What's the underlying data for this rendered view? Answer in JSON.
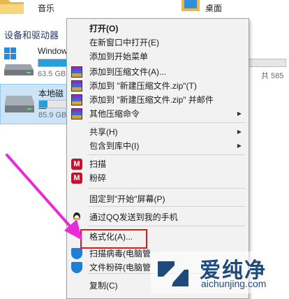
{
  "explorer": {
    "folders": [
      {
        "label": "音乐"
      },
      {
        "label": "桌面"
      }
    ],
    "section_title": "设备和驱动器",
    "drives": [
      {
        "name": "Windows",
        "size_text": "63.5 GB",
        "free_text": "共 585",
        "used_fraction": 0.85
      },
      {
        "name": "本地磁盘",
        "size_text": "85.9 GB",
        "used_fraction": 0.3
      }
    ]
  },
  "menu": {
    "items": [
      {
        "label": "打开(O)",
        "bold": true
      },
      {
        "label": "在新窗口中打开(E)"
      },
      {
        "label": "添加到开始菜单"
      },
      {
        "label": "添加到压缩文件(A)...",
        "icon": "winrar-icon"
      },
      {
        "label": "添加到 \"新建压缩文件.zip\"(T)",
        "icon": "winrar-icon"
      },
      {
        "label": "添加到 \"新建压缩文件.zip\" 并邮件",
        "icon": "winrar-icon"
      },
      {
        "label": "其他压缩命令",
        "icon": "winrar-icon",
        "submenu": true
      },
      {
        "label": "共享(H)",
        "submenu": true
      },
      {
        "label": "包含到库中(I)",
        "submenu": true
      },
      {
        "label": "扫描",
        "icon": "mcafee-icon"
      },
      {
        "label": "粉碎",
        "icon": "mcafee-icon"
      },
      {
        "label": "固定到\"开始\"屏幕(P)"
      },
      {
        "label": "通过QQ发送到我的手机",
        "icon": "qq-icon"
      },
      {
        "label": "格式化(A)...",
        "highlighted": true
      },
      {
        "label": "扫描病毒(电脑管",
        "icon": "shield-icon"
      },
      {
        "label": "文件粉碎(电脑管",
        "icon": "shield-icon"
      },
      {
        "label": "复制(C)"
      }
    ]
  },
  "watermark": {
    "title": "爱纯净",
    "url": "aichunjing.com"
  },
  "colors": {
    "highlight_border": "#e01818",
    "arrow": "#e82bd8",
    "accent_bar": "#26a0da"
  }
}
